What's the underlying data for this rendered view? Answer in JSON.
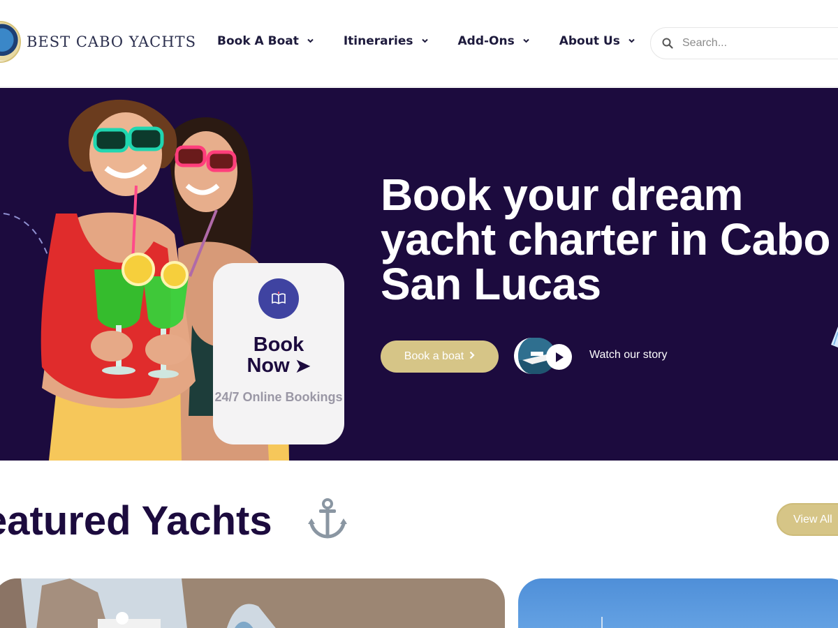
{
  "brand": {
    "name": "BEST CABO YACHTS"
  },
  "nav": {
    "items": [
      {
        "label": "Book A Boat"
      },
      {
        "label": "Itineraries"
      },
      {
        "label": "Add-Ons"
      },
      {
        "label": "About Us"
      }
    ]
  },
  "search": {
    "placeholder": "Search..."
  },
  "hero": {
    "title": "Book your dream yacht charter in Cabo San Lucas",
    "book_button": "Book a boat",
    "watch_label": "Watch our story",
    "card": {
      "title_line1": "Book",
      "title_line2": "Now",
      "arrow": "➤",
      "subtitle": "24/7 Online Bookings"
    }
  },
  "featured": {
    "title": "eatured Yachts",
    "view_all": "View All"
  },
  "colors": {
    "hero_bg": "#1c0b3e",
    "accent_gold": "#d6c587",
    "card_icon": "#3f43a1"
  },
  "icons": [
    "chevron-down-icon",
    "search-icon",
    "book-icon",
    "chevron-right-icon",
    "play-icon",
    "anchor-icon"
  ]
}
